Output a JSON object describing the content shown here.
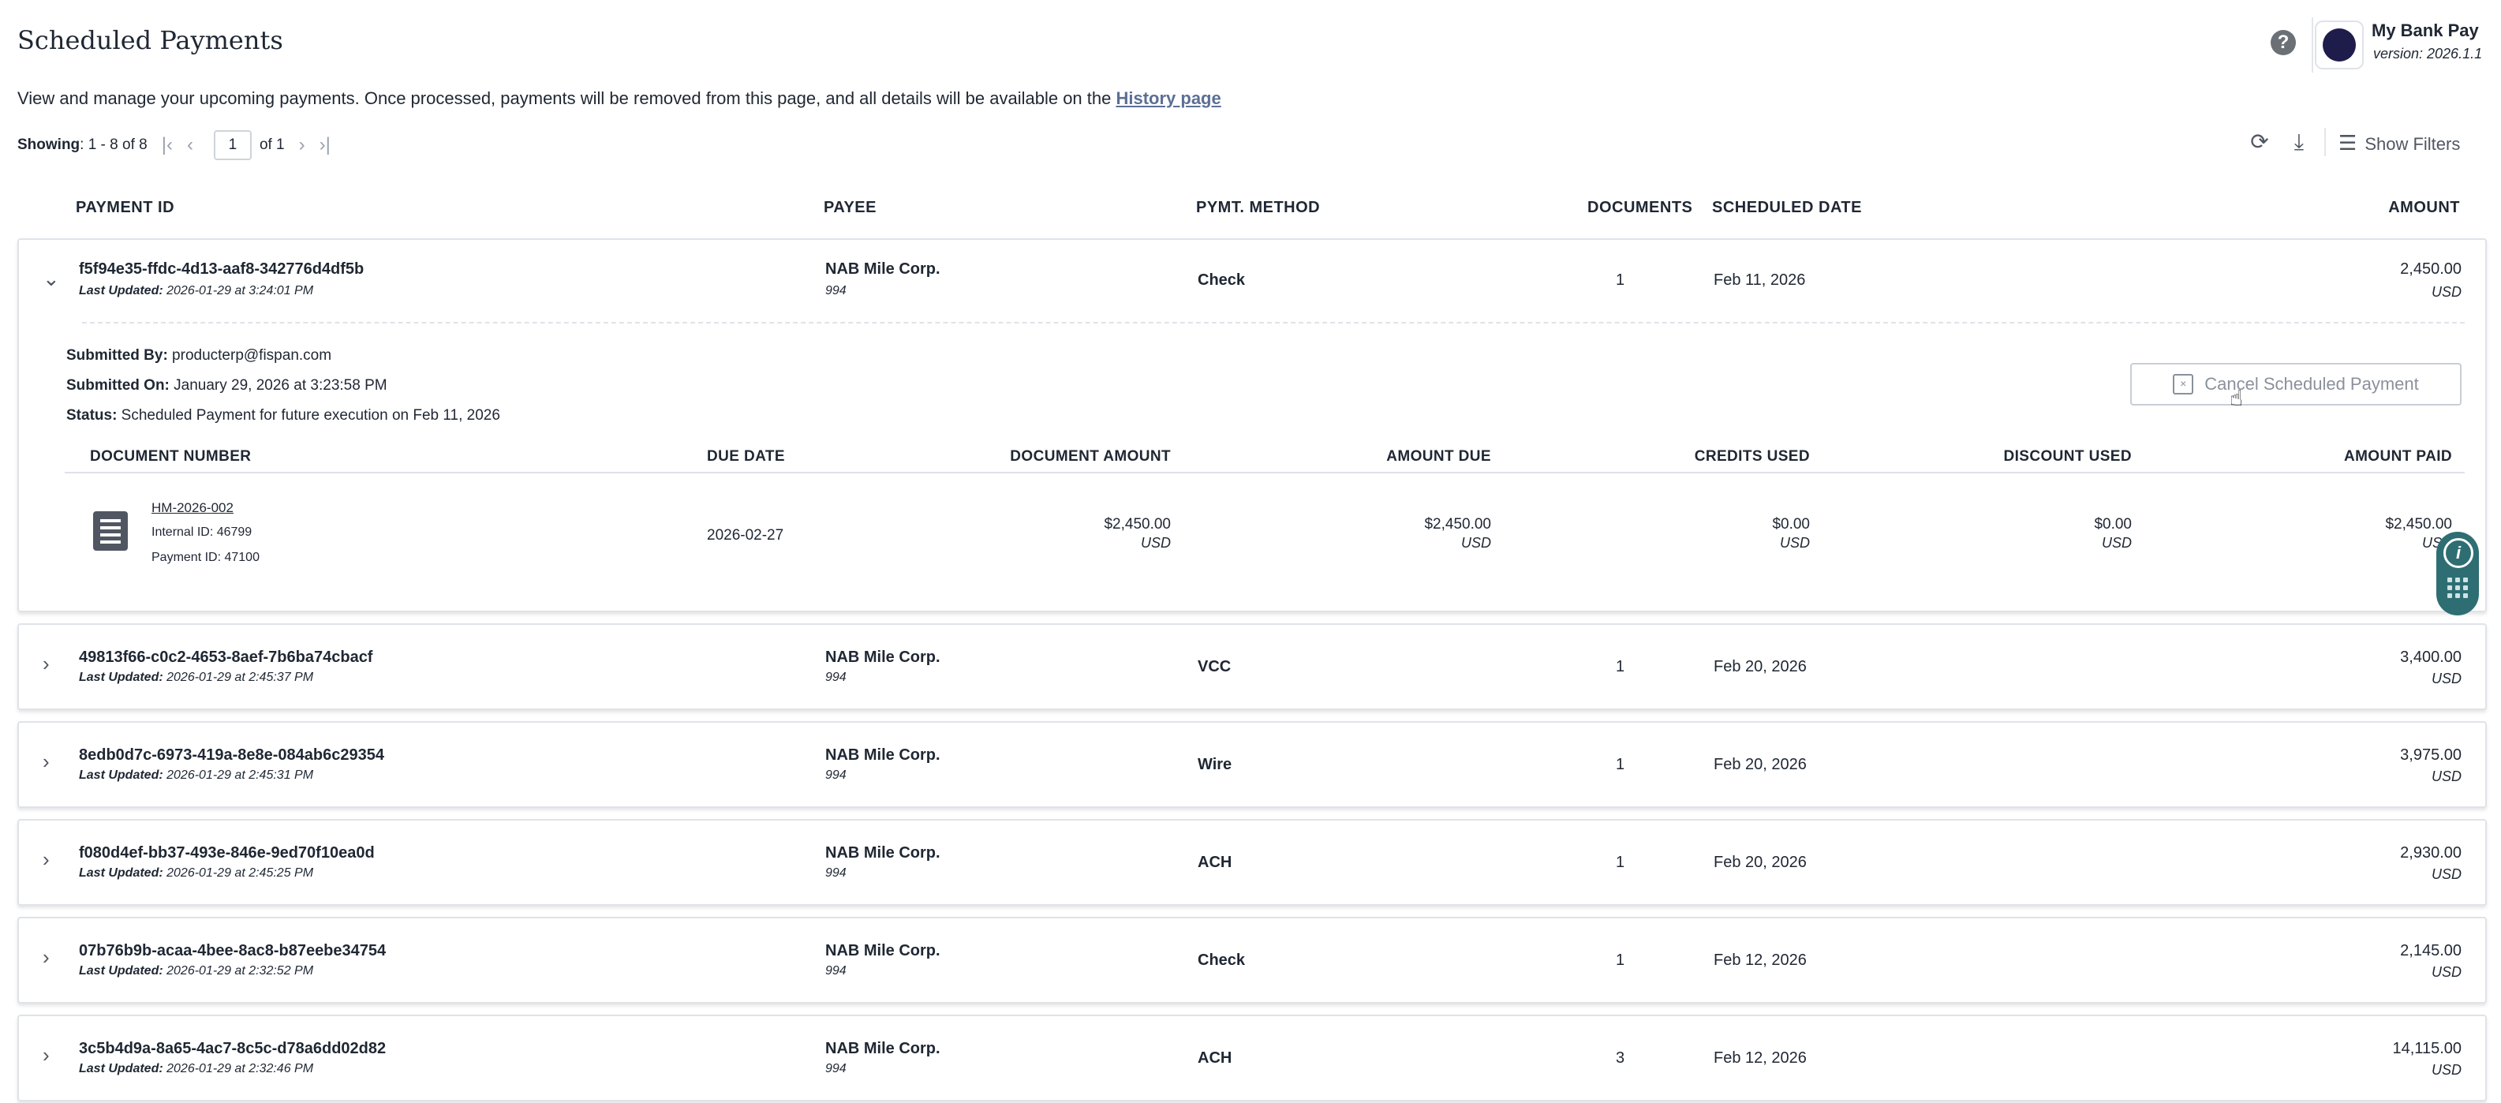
{
  "header": {
    "title": "Scheduled Payments",
    "subtitle": "View and manage your upcoming payments. Once processed, payments will be removed from this page, and all details will be available on the ",
    "history_link": "History page"
  },
  "app": {
    "name": "My Bank Pay",
    "version": "version: 2026.1.1"
  },
  "pager": {
    "showing_label": "Showing",
    "range": ": 1 - 8 of 8",
    "page": "1",
    "of": "of 1"
  },
  "toolbar": {
    "show_filters": "Show Filters"
  },
  "columns": {
    "payment_id": "PAYMENT ID",
    "payee": "PAYEE",
    "method": "PYMT. METHOD",
    "documents": "DOCUMENTS",
    "scheduled_date": "SCHEDULED DATE",
    "amount": "AMOUNT"
  },
  "rows": [
    {
      "id": "f5f94e35-ffdc-4d13-aaf8-342776d4df5b",
      "updated_label": "Last Updated:",
      "updated": "2026-01-29 at 3:24:01 PM",
      "payee": "NAB Mile Corp.",
      "payee_id": "994",
      "method": "Check",
      "documents": "1",
      "date": "Feb 11, 2026",
      "amount": "2,450.00",
      "currency": "USD"
    },
    {
      "id": "49813f66-c0c2-4653-8aef-7b6ba74cbacf",
      "updated_label": "Last Updated:",
      "updated": "2026-01-29 at 2:45:37 PM",
      "payee": "NAB Mile Corp.",
      "payee_id": "994",
      "method": "VCC",
      "documents": "1",
      "date": "Feb 20, 2026",
      "amount": "3,400.00",
      "currency": "USD"
    },
    {
      "id": "8edb0d7c-6973-419a-8e8e-084ab6c29354",
      "updated_label": "Last Updated:",
      "updated": "2026-01-29 at 2:45:31 PM",
      "payee": "NAB Mile Corp.",
      "payee_id": "994",
      "method": "Wire",
      "documents": "1",
      "date": "Feb 20, 2026",
      "amount": "3,975.00",
      "currency": "USD"
    },
    {
      "id": "f080d4ef-bb37-493e-846e-9ed70f10ea0d",
      "updated_label": "Last Updated:",
      "updated": "2026-01-29 at 2:45:25 PM",
      "payee": "NAB Mile Corp.",
      "payee_id": "994",
      "method": "ACH",
      "documents": "1",
      "date": "Feb 20, 2026",
      "amount": "2,930.00",
      "currency": "USD"
    },
    {
      "id": "07b76b9b-acaa-4bee-8ac8-b87eebe34754",
      "updated_label": "Last Updated:",
      "updated": "2026-01-29 at 2:32:52 PM",
      "payee": "NAB Mile Corp.",
      "payee_id": "994",
      "method": "Check",
      "documents": "1",
      "date": "Feb 12, 2026",
      "amount": "2,145.00",
      "currency": "USD"
    },
    {
      "id": "3c5b4d9a-8a65-4ac7-8c5c-d78a6dd02d82",
      "updated_label": "Last Updated:",
      "updated": "2026-01-29 at 2:32:46 PM",
      "payee": "NAB Mile Corp.",
      "payee_id": "994",
      "method": "ACH",
      "documents": "3",
      "date": "Feb 12, 2026",
      "amount": "14,115.00",
      "currency": "USD"
    }
  ],
  "expanded": {
    "submitted_by_label": "Submitted By:",
    "submitted_by": " producterp@fispan.com",
    "submitted_on_label": "Submitted On:",
    "submitted_on": " January 29, 2026 at 3:23:58 PM",
    "status_label": "Status:",
    "status": " Scheduled Payment for future execution on Feb 11, 2026",
    "cancel_label": "Cancel Scheduled Payment",
    "doc_columns": {
      "number": "DOCUMENT NUMBER",
      "due_date": "DUE DATE",
      "doc_amount": "DOCUMENT AMOUNT",
      "amount_due": "AMOUNT DUE",
      "credits": "CREDITS USED",
      "discount": "DISCOUNT USED",
      "paid": "AMOUNT PAID"
    },
    "doc": {
      "number": "HM-2026-002",
      "internal_id": "Internal ID: 46799",
      "payment_id": "Payment ID: 47100",
      "due_date": "2026-02-27",
      "doc_amount": "$2,450.00",
      "amount_due": "$2,450.00",
      "credits": "$0.00",
      "discount": "$0.00",
      "paid": "$2,450.00",
      "currency": "USD"
    }
  },
  "widget": {
    "info_glyph": "i"
  }
}
